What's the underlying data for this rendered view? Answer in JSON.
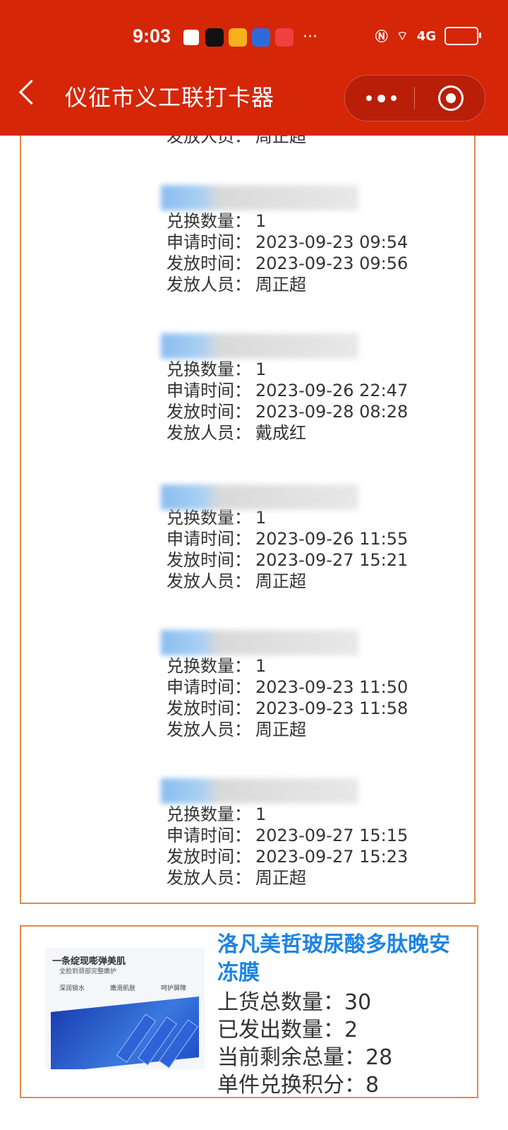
{
  "status_bar": {
    "time": "9:03",
    "network": "4G"
  },
  "header": {
    "title": "仪征市义工联打卡器"
  },
  "top_partial": {
    "label": "发放人员：",
    "value": "周正超"
  },
  "labels": {
    "quantity": "兑换数量：",
    "apply_time": "申请时间：",
    "issue_time": "发放时间：",
    "issuer": "发放人员："
  },
  "records": [
    {
      "quantity": "1",
      "apply_time": "2023-09-23 09:54",
      "issue_time": "2023-09-23 09:56",
      "issuer": "周正超"
    },
    {
      "quantity": "1",
      "apply_time": "2023-09-26 22:47",
      "issue_time": "2023-09-28 08:28",
      "issuer": "戴成红"
    },
    {
      "quantity": "1",
      "apply_time": "2023-09-26 11:55",
      "issue_time": "2023-09-27 15:21",
      "issuer": "周正超"
    },
    {
      "quantity": "1",
      "apply_time": "2023-09-23 11:50",
      "issue_time": "2023-09-23 11:58",
      "issuer": "周正超"
    },
    {
      "quantity": "1",
      "apply_time": "2023-09-27 15:15",
      "issue_time": "2023-09-27 15:23",
      "issuer": "周正超"
    }
  ],
  "product": {
    "title": "洛凡美哲玻尿酸多肽晚安冻膜",
    "total_label": "上货总数量：",
    "total": "30",
    "sent_label": "已发出数量：",
    "sent": "2",
    "remaining_label": "当前剩余总量：",
    "remaining": "28",
    "points_label": "单件兑换积分：",
    "points": "8",
    "image": {
      "headline": "一条绽现嘭弹美肌",
      "subline": "全脸到颈部完整嫩护",
      "feature1": "深润锁水",
      "feature2": "嫩滑肌肤",
      "feature3": "呵护屏障"
    }
  }
}
